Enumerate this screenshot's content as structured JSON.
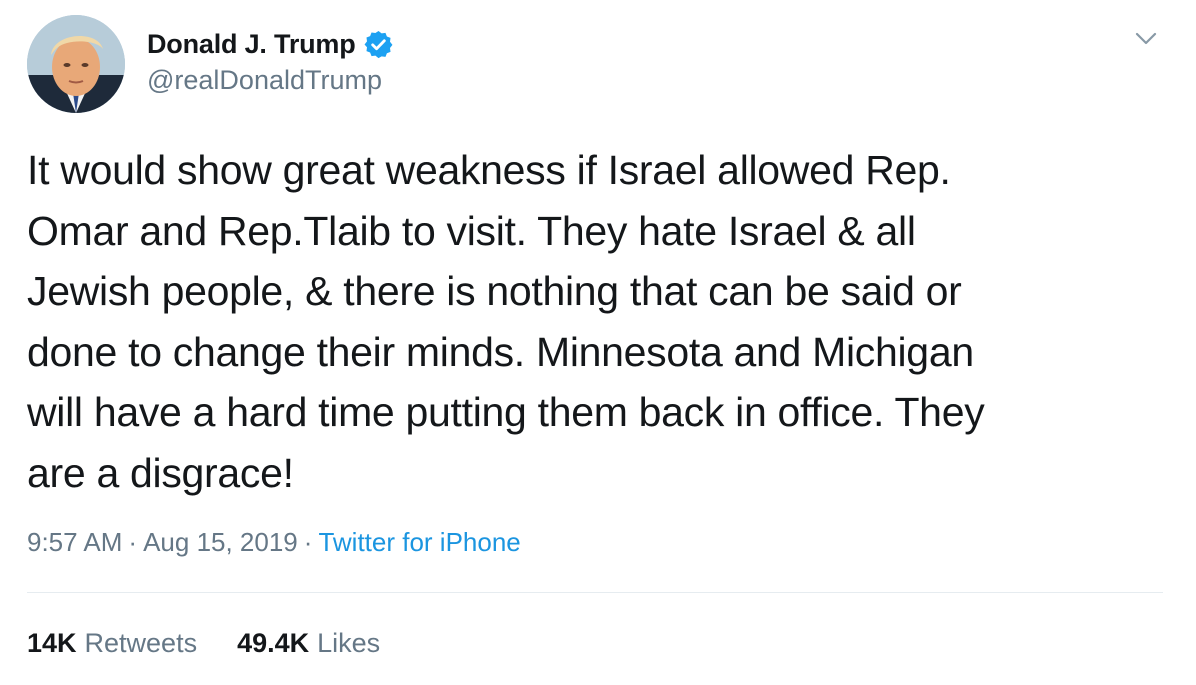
{
  "author": {
    "display_name": "Donald J. Trump",
    "handle": "@realDonaldTrump",
    "verified": true,
    "verified_icon": "verified-badge-icon",
    "avatar": "profile-photo"
  },
  "tweet": {
    "text": "It would show great weakness if Israel allowed Rep.\nOmar and Rep.Tlaib to visit. They hate Israel & all\nJewish people, & there is nothing that can be said or\ndone to change their minds. Minnesota and Michigan\nwill have a hard time putting them back in office. They\nare a disgrace!"
  },
  "meta": {
    "time": "9:57 AM",
    "separator": "·",
    "date": "Aug 15, 2019",
    "source": "Twitter for iPhone"
  },
  "stats": {
    "retweets_count": "14K",
    "retweets_label": "Retweets",
    "likes_count": "49.4K",
    "likes_label": "Likes"
  },
  "colors": {
    "text_primary": "#14171a",
    "text_secondary": "#657786",
    "link": "#1b95e0",
    "verified": "#1da1f2",
    "divider": "#e6ecf0"
  },
  "icons": {
    "menu": "chevron-down-icon"
  }
}
